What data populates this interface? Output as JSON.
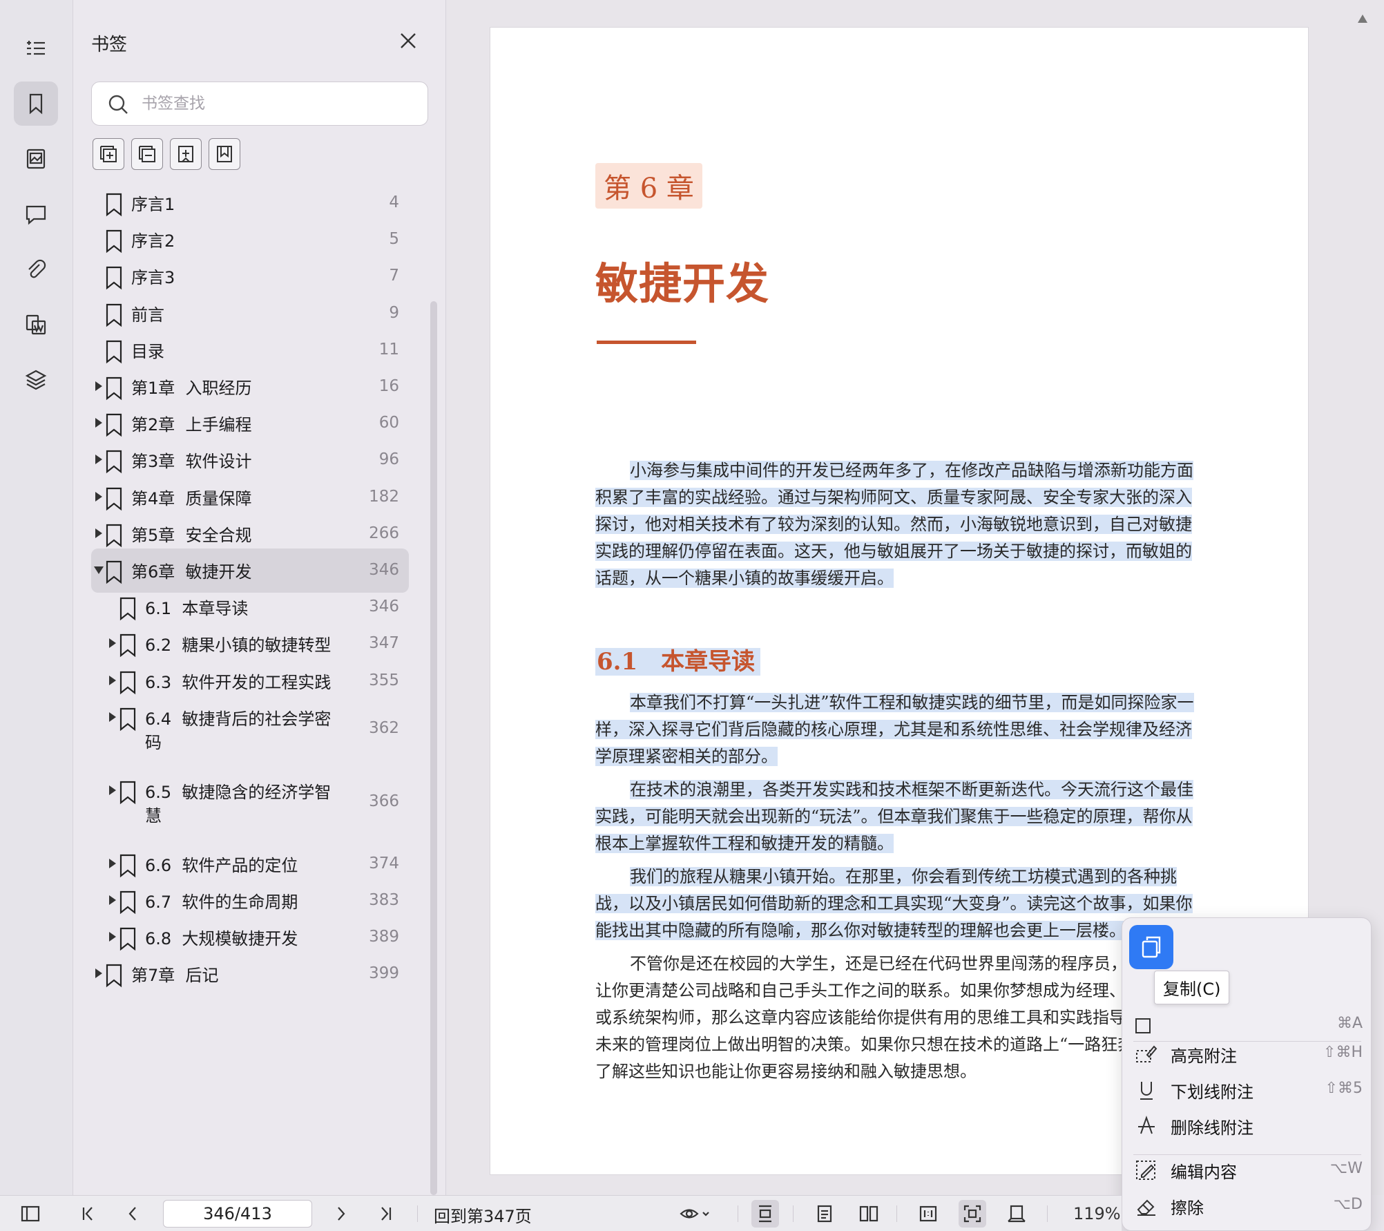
{
  "panel": {
    "title": "书签",
    "search_placeholder": "书签查找"
  },
  "bookmarks": [
    {
      "label": "序言1",
      "page": "4",
      "level": 0,
      "expand": "none"
    },
    {
      "label": "序言2",
      "page": "5",
      "level": 0,
      "expand": "none"
    },
    {
      "label": "序言3",
      "page": "7",
      "level": 0,
      "expand": "none"
    },
    {
      "label": "前言",
      "page": "9",
      "level": 0,
      "expand": "none"
    },
    {
      "label": "目录",
      "page": "11",
      "level": 0,
      "expand": "none"
    },
    {
      "label": "第1章  入职经历",
      "page": "16",
      "level": 0,
      "expand": "collapsed"
    },
    {
      "label": "第2章  上手编程",
      "page": "60",
      "level": 0,
      "expand": "collapsed"
    },
    {
      "label": "第3章  软件设计",
      "page": "96",
      "level": 0,
      "expand": "collapsed"
    },
    {
      "label": "第4章  质量保障",
      "page": "182",
      "level": 0,
      "expand": "collapsed"
    },
    {
      "label": "第5章  安全合规",
      "page": "266",
      "level": 0,
      "expand": "collapsed"
    },
    {
      "label": "第6章  敏捷开发",
      "page": "346",
      "level": 0,
      "expand": "expanded",
      "selected": true
    },
    {
      "label": "6.1  本章导读",
      "page": "346",
      "level": 1,
      "expand": "none"
    },
    {
      "label": "6.2  糖果小镇的敏捷转型",
      "page": "347",
      "level": 1,
      "expand": "collapsed"
    },
    {
      "label": "6.3  软件开发的工程实践",
      "page": "355",
      "level": 1,
      "expand": "collapsed"
    },
    {
      "label": "6.4  敏捷背后的社会学密\n码",
      "page": "362",
      "level": 1,
      "expand": "collapsed"
    },
    {
      "label": "6.5  敏捷隐含的经济学智\n慧",
      "page": "366",
      "level": 1,
      "expand": "collapsed"
    },
    {
      "label": "6.6  软件产品的定位",
      "page": "374",
      "level": 1,
      "expand": "collapsed"
    },
    {
      "label": "6.7  软件的生命周期",
      "page": "383",
      "level": 1,
      "expand": "collapsed"
    },
    {
      "label": "6.8  大规模敏捷开发",
      "page": "389",
      "level": 1,
      "expand": "collapsed"
    },
    {
      "label": "第7章  后记",
      "page": "399",
      "level": 0,
      "expand": "collapsed"
    }
  ],
  "document": {
    "chapter_badge": "第 6 章",
    "chapter_title": "敏捷开发",
    "intro": "小海参与集成中间件的开发已经两年多了，在修改产品缺陷与增添新功能方面积累了丰富的实战经验。通过与架构师阿文、质量专家阿晟、安全专家大张的深入探讨，他对相关技术有了较为深刻的认知。然而，小海敏锐地意识到，自己对敏捷实践的理解仍停留在表面。这天，他与敏姐展开了一场关于敏捷的探讨，而敏姐的话题，从一个糖果小镇的故事缓缓开启。",
    "section_title": "6.1　本章导读",
    "p1": "本章我们不打算“一头扎进”软件工程和敏捷实践的细节里，而是如同探险家一样，深入探寻它们背后隐藏的核心原理，尤其是和系统性思维、社会学规律及经济学原理紧密相关的部分。",
    "p2": "在技术的浪潮里，各类开发实践和技术框架不断更新迭代。今天流行这个最佳实践，可能明天就会出现新的“玩法”。但本章我们聚焦于一些稳定的原理，帮你从根本上掌握软件工程和敏捷开发的精髓。",
    "p3": "我们的旅程从糖果小镇开始。在那里，你会看到传统工坊模式遇到的各种挑战，以及小镇居民如何借助新的理念和工具实现“大变身”。读完这个故事，如果你能找出其中隐藏的所有隐喻，那么你对敏捷转型的理解也会更上一层楼。",
    "p4": "不管你是还在校园的大学生，还是已经在代码世界里闯荡的程序员，本章都能让你更清楚公司战略和自己手头工作之间的联系。如果你梦想成为经理、产品总监或系统架构师，那么这章内容应该能给你提供有用的思维工具和实践指导，让你在未来的管理岗位上做出明智的决策。如果你只想在技术的道路上“一路狂奔”，那么了解这些知识也能让你更容易接纳和融入敏捷思想。"
  },
  "context_menu": {
    "copy_tooltip": "复制(C)",
    "select_all_shortcut": "⌘A",
    "items": [
      {
        "label": "高亮附注",
        "shortcut": "⇧⌘H",
        "icon": "highlight-icon"
      },
      {
        "label": "下划线附注",
        "shortcut": "⇧⌘5",
        "icon": "underline-icon"
      },
      {
        "label": "删除线附注",
        "shortcut": "",
        "icon": "strikethrough-icon"
      },
      {
        "label": "编辑内容",
        "shortcut": "⌥W",
        "icon": "edit-icon"
      },
      {
        "label": "擦除",
        "shortcut": "⌥D",
        "icon": "eraser-icon"
      }
    ]
  },
  "bottombar": {
    "page_value": "346/413",
    "back_link": "回到第347页",
    "zoom": "119%"
  }
}
